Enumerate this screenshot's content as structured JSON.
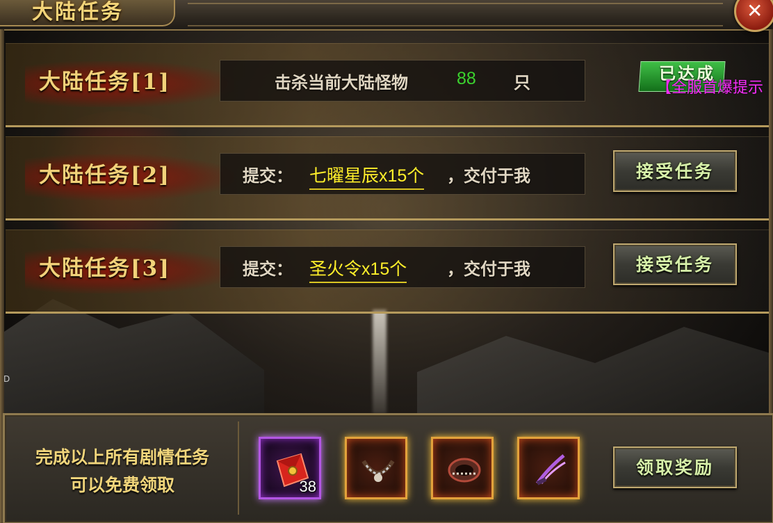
{
  "window": {
    "title": "大陆任务",
    "close_label": "✕"
  },
  "tasks": [
    {
      "label": "大陆任务[1]",
      "text_before": "击杀当前大陆怪物",
      "count": "88",
      "text_after": "只",
      "status": "已达成"
    },
    {
      "label": "大陆任务[2]",
      "text_before": "提交：",
      "item": "七曜星辰x15个",
      "text_after": "，交付于我",
      "button": "接受任务"
    },
    {
      "label": "大陆任务[3]",
      "text_before": "提交：",
      "item": "圣火令x15个",
      "text_after": "，交付于我",
      "button": "接受任务"
    }
  ],
  "broadcast": "【全服首爆提示",
  "side_mark": "D",
  "reward": {
    "text_line1": "完成以上所有剧情任务",
    "text_line2": "可以免费领取",
    "button": "领取奖励",
    "items": [
      {
        "icon": "red-envelope-icon",
        "count": "38",
        "frame_color": "#b356e4"
      },
      {
        "icon": "necklace-icon",
        "frame_color": "#e3a23b"
      },
      {
        "icon": "bracelet-icon",
        "frame_color": "#e3a23b"
      },
      {
        "icon": "claw-weapon-icon",
        "frame_color": "#e3a23b"
      }
    ]
  },
  "colors": {
    "title": "#f3d479",
    "highlight": "#ffef2a",
    "count": "#3bd22e",
    "broadcast": "#f22ef5",
    "button_text": "#d7f0a9"
  }
}
